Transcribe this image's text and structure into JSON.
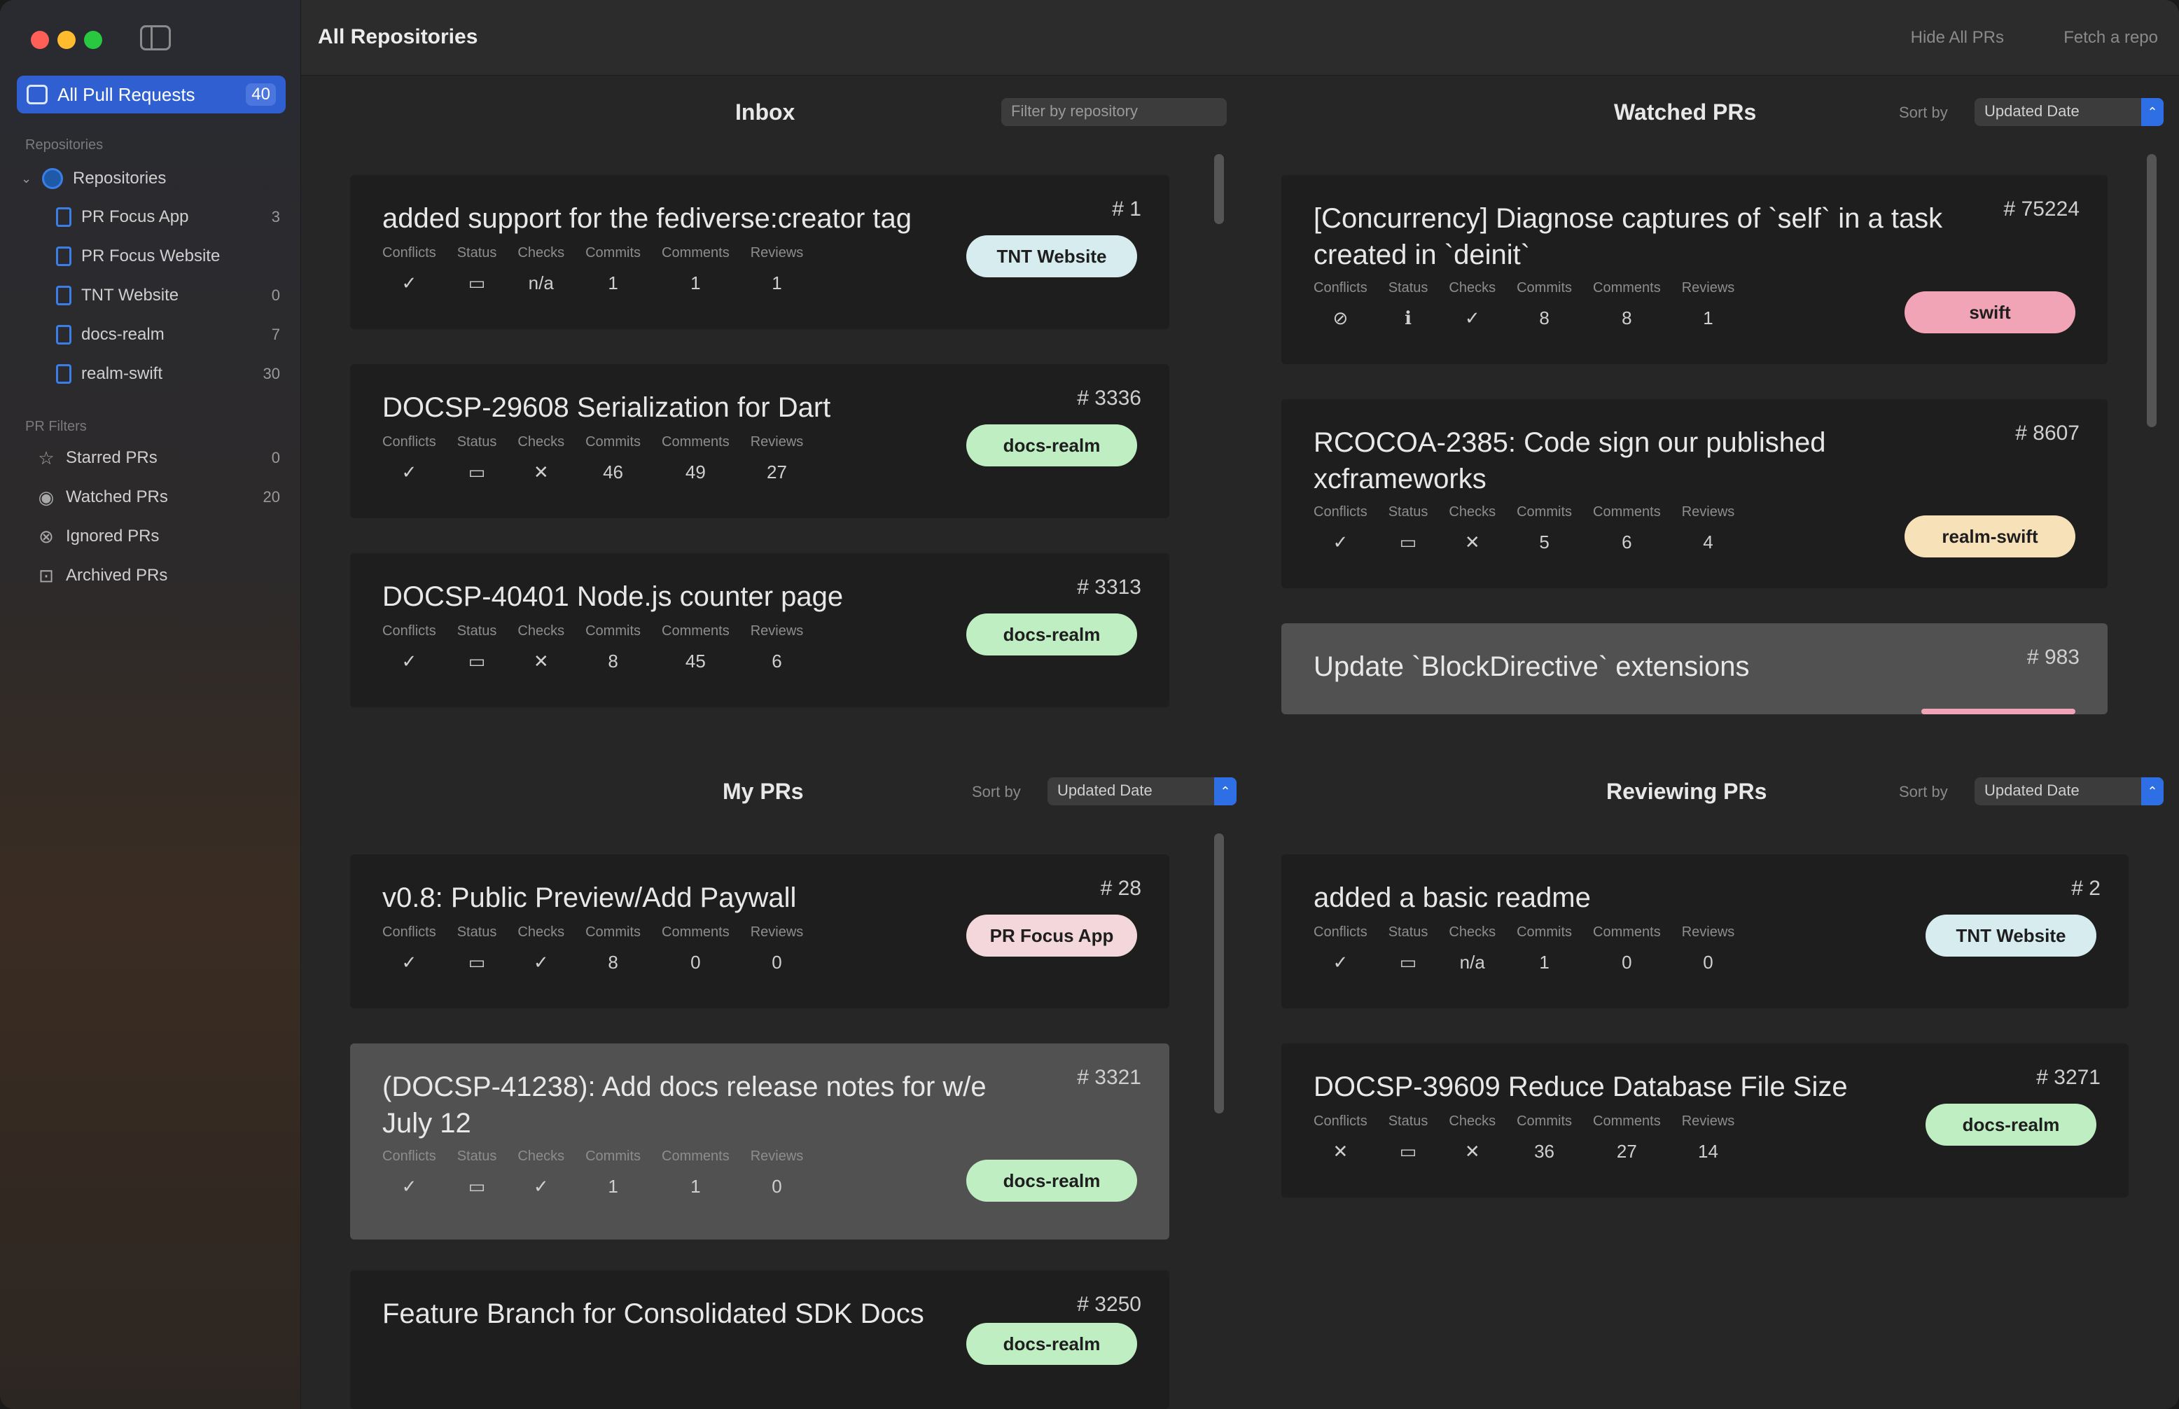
{
  "window": {
    "title": "All Repositories",
    "actions": [
      "Hide All PRs",
      "Fetch a repo"
    ]
  },
  "sidebar": {
    "selected": {
      "label": "All Pull Requests",
      "count": "40"
    },
    "repositories_header": "Repositories",
    "repositories_root": "Repositories",
    "repos": [
      {
        "label": "PR Focus App",
        "count": "3"
      },
      {
        "label": "PR Focus Website",
        "count": ""
      },
      {
        "label": "TNT Website",
        "count": "0"
      },
      {
        "label": "docs-realm",
        "count": "7"
      },
      {
        "label": "realm-swift",
        "count": "30"
      }
    ],
    "filters_header": "PR Filters",
    "filters": [
      {
        "label": "Starred PRs",
        "count": "0",
        "icon": "star-icon"
      },
      {
        "label": "Watched PRs",
        "count": "20",
        "icon": "eye-icon"
      },
      {
        "label": "Ignored PRs",
        "count": "",
        "icon": "ignore-icon"
      },
      {
        "label": "Archived PRs",
        "count": "",
        "icon": "archive-icon"
      }
    ]
  },
  "metric_headers": [
    "Conflicts",
    "Status",
    "Checks",
    "Commits",
    "Comments",
    "Reviews"
  ],
  "panels": {
    "inbox": {
      "title": "Inbox",
      "filter": "Filter by repository",
      "cards": [
        {
          "title": "added support for the fediverse:creator tag",
          "number": "# 1",
          "m": [
            "✓",
            "▭",
            "n/a",
            "1",
            "1",
            "1"
          ],
          "mc": [
            "ok",
            "ok",
            "dim",
            "",
            "",
            ""
          ],
          "pill": "TNT Website",
          "pill_color": "#d7ecef"
        },
        {
          "title": "DOCSP-29608 Serialization for Dart",
          "number": "# 3336",
          "m": [
            "✓",
            "▭",
            "✕",
            "46",
            "49",
            "27"
          ],
          "mc": [
            "ok",
            "ok",
            "bad",
            "",
            "",
            ""
          ],
          "pill": "docs-realm",
          "pill_color": "#bfeec3"
        },
        {
          "title": "DOCSP-40401 Node.js counter page",
          "number": "# 3313",
          "m": [
            "✓",
            "▭",
            "✕",
            "8",
            "45",
            "6"
          ],
          "mc": [
            "ok",
            "ok",
            "bad",
            "",
            "",
            ""
          ],
          "pill": "docs-realm",
          "pill_color": "#bfeec3"
        }
      ]
    },
    "watched": {
      "title": "Watched PRs",
      "sort_label": "Sort by",
      "sort_value": "Updated Date",
      "cards": [
        {
          "title": "[Concurrency] Diagnose captures of `self` in a task created in `deinit`",
          "number": "# 75224",
          "m": [
            "⊘",
            "ℹ",
            "✓",
            "8",
            "8",
            "1"
          ],
          "mc": [
            "dim",
            "purple",
            "ok",
            "",
            "",
            ""
          ],
          "pill": "swift",
          "pill_color": "#f2a4b7"
        },
        {
          "title": "RCOCOA-2385: Code sign our published xcframeworks",
          "number": "# 8607",
          "m": [
            "✓",
            "▭",
            "✕",
            "5",
            "6",
            "4"
          ],
          "mc": [
            "ok",
            "ok",
            "bad",
            "",
            "",
            ""
          ],
          "pill": "realm-swift",
          "pill_color": "#f6e1b8"
        },
        {
          "title": "Update `BlockDirective` extensions",
          "number": "# 983",
          "m": [],
          "mc": [],
          "pill": "",
          "pill_color": "#f2a4b7"
        }
      ]
    },
    "mine": {
      "title": "My PRs",
      "sort_label": "Sort by",
      "sort_value": "Updated Date",
      "cards": [
        {
          "title": "v0.8: Public Preview/Add Paywall",
          "number": "# 28",
          "m": [
            "✓",
            "▭",
            "✓",
            "8",
            "0",
            "0"
          ],
          "mc": [
            "ok",
            "ok",
            "ok",
            "",
            "",
            ""
          ],
          "pill": "PR Focus App",
          "pill_color": "#f3d7db"
        },
        {
          "title": "(DOCSP-41238): Add docs release notes for w/e July 12",
          "number": "# 3321",
          "m": [
            "✓",
            "▭",
            "✓",
            "1",
            "1",
            "0"
          ],
          "mc": [
            "ok",
            "ok",
            "ok",
            "",
            "",
            ""
          ],
          "pill": "docs-realm",
          "pill_color": "#bfeec3"
        },
        {
          "title": "Feature Branch for Consolidated SDK Docs",
          "number": "# 3250",
          "m": [],
          "mc": [],
          "pill": "docs-realm",
          "pill_color": "#bfeec3"
        }
      ]
    },
    "reviewing": {
      "title": "Reviewing PRs",
      "sort_label": "Sort by",
      "sort_value": "Updated Date",
      "cards": [
        {
          "title": "added a basic readme",
          "number": "# 2",
          "m": [
            "✓",
            "▭",
            "n/a",
            "1",
            "0",
            "0"
          ],
          "mc": [
            "ok",
            "ok",
            "dim",
            "",
            "",
            ""
          ],
          "pill": "TNT Website",
          "pill_color": "#d7ecef"
        },
        {
          "title": "DOCSP-39609 Reduce Database File Size",
          "number": "# 3271",
          "m": [
            "✕",
            "▭",
            "✕",
            "36",
            "27",
            "14"
          ],
          "mc": [
            "bad",
            "ok",
            "bad",
            "",
            "",
            ""
          ],
          "pill": "docs-realm",
          "pill_color": "#bfeec3"
        }
      ]
    }
  }
}
